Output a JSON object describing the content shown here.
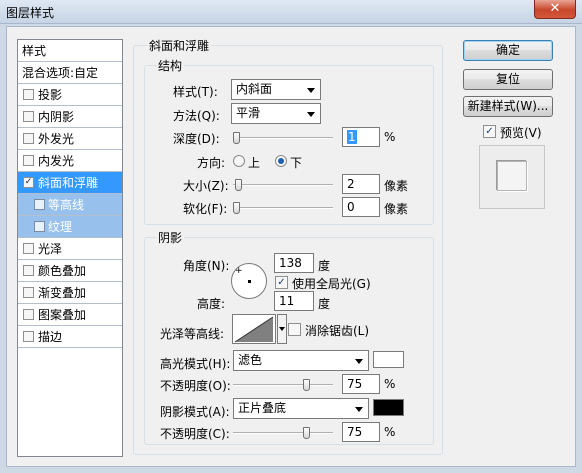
{
  "window": {
    "title": "图层样式",
    "close_glyph": "✕"
  },
  "style_list": {
    "header": "样式",
    "blend": "混合选项:自定",
    "items": [
      {
        "label": "投影",
        "checked": false
      },
      {
        "label": "内阴影",
        "checked": false
      },
      {
        "label": "外发光",
        "checked": false
      },
      {
        "label": "内发光",
        "checked": false
      },
      {
        "label": "斜面和浮雕",
        "checked": true,
        "selected": true
      },
      {
        "label": "等高线",
        "checked": false,
        "sub": true
      },
      {
        "label": "纹理",
        "checked": false,
        "sub": true
      },
      {
        "label": "光泽",
        "checked": false
      },
      {
        "label": "颜色叠加",
        "checked": false
      },
      {
        "label": "渐变叠加",
        "checked": false
      },
      {
        "label": "图案叠加",
        "checked": false
      },
      {
        "label": "描边",
        "checked": false
      }
    ],
    "check_mark": "✓"
  },
  "buttons": {
    "ok": "确定",
    "reset": "复位",
    "new_style": "新建样式(W)...",
    "preview": "预览(V)",
    "preview_checked": true
  },
  "bevel": {
    "title": "斜面和浮雕",
    "structure": {
      "title": "结构",
      "style_label": "样式(T):",
      "style_value": "内斜面",
      "technique_label": "方法(Q):",
      "technique_value": "平滑",
      "depth_label": "深度(D):",
      "depth_value": "1",
      "depth_unit": "%",
      "depth_slider": 0.0,
      "direction_label": "方向:",
      "direction_up": "上",
      "direction_down": "下",
      "direction_selected": "下",
      "size_label": "大小(Z):",
      "size_value": "2",
      "size_unit": "像素",
      "size_slider": 0.02,
      "soften_label": "软化(F):",
      "soften_value": "0",
      "soften_unit": "像素",
      "soften_slider": 0.0
    },
    "shading": {
      "title": "阴影",
      "angle_label": "角度(N):",
      "angle_value": "138",
      "angle_unit": "度",
      "global_light_label": "使用全局光(G)",
      "global_light_checked": true,
      "altitude_label": "高度:",
      "altitude_value": "11",
      "altitude_unit": "度",
      "gloss_label": "光泽等高线:",
      "antialias_label": "消除锯齿(L)",
      "antialias_checked": false,
      "highlight_label": "高光模式(H):",
      "highlight_mode": "滤色",
      "highlight_color": "#ffffff",
      "highlight_opacity_label": "不透明度(O):",
      "highlight_opacity": "75",
      "highlight_opacity_unit": "%",
      "highlight_slider": 0.75,
      "shadow_label": "阴影模式(A):",
      "shadow_mode": "正片叠底",
      "shadow_color": "#000000",
      "shadow_opacity_label": "不透明度(C):",
      "shadow_opacity": "75",
      "shadow_opacity_unit": "%",
      "shadow_slider": 0.75
    }
  }
}
